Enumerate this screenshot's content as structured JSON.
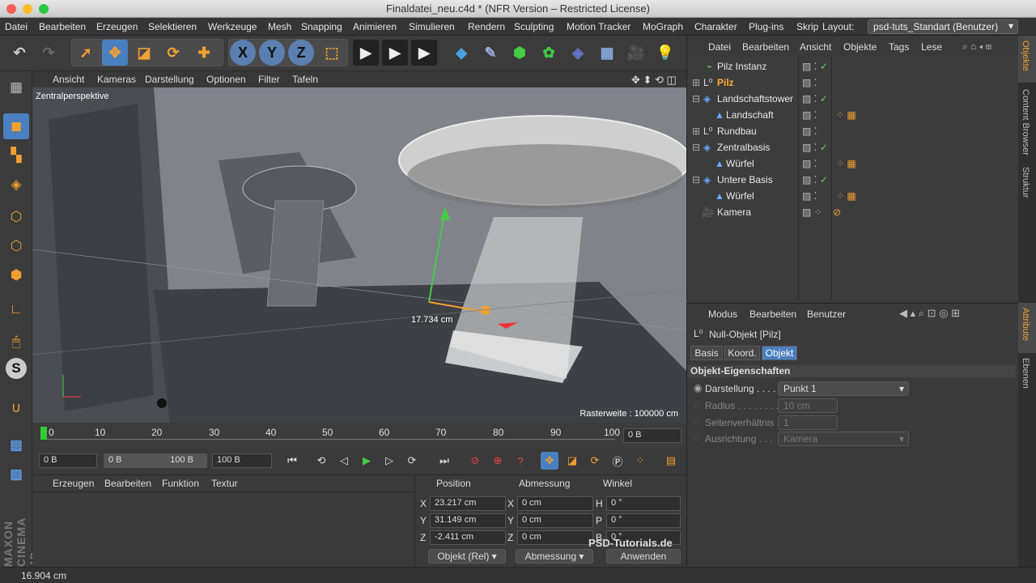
{
  "window": {
    "title": "Finaldatei_neu.c4d * (NFR Version – Restricted License)"
  },
  "menubar": {
    "items": [
      "Datei",
      "Bearbeiten",
      "Erzeugen",
      "Selektieren",
      "Werkzeuge",
      "Mesh",
      "Snapping",
      "Animieren",
      "Simulieren",
      "Rendern",
      "Sculpting",
      "Motion Tracker",
      "MoGraph",
      "Charakter",
      "Plug-ins",
      "Skrip"
    ],
    "layout_label": "Layout:",
    "layout_value": "psd-tuts_Standart (Benutzer)"
  },
  "toolbar": {
    "axis_x": "X",
    "axis_y": "Y",
    "axis_z": "Z"
  },
  "viewport": {
    "menu": [
      "Ansicht",
      "Kameras",
      "Darstellung",
      "Optionen",
      "Filter",
      "Tafeln"
    ],
    "camera_label": "Zentralperspektive",
    "measure_label": "17.734 cm",
    "grid_label": "Rasterweite : 100000 cm"
  },
  "timeline": {
    "ticks": [
      "0",
      "10",
      "20",
      "30",
      "40",
      "50",
      "60",
      "70",
      "80",
      "90",
      "100"
    ],
    "current_frame": "0 B"
  },
  "transport": {
    "start_field": "0 B",
    "range_start": "0 B",
    "range_end": "100 B",
    "end_field": "100 B"
  },
  "material_panel": {
    "menu": [
      "Erzeugen",
      "Bearbeiten",
      "Funktion",
      "Textur"
    ]
  },
  "coords": {
    "headers": [
      "Position",
      "Abmessung",
      "Winkel"
    ],
    "rows": [
      {
        "axis": "X",
        "pos": "23.217 cm",
        "dim_axis": "X",
        "dim": "0 cm",
        "ang_axis": "H",
        "ang": "0 °"
      },
      {
        "axis": "Y",
        "pos": "31.149 cm",
        "dim_axis": "Y",
        "dim": "0 cm",
        "ang_axis": "P",
        "ang": "0 °"
      },
      {
        "axis": "Z",
        "pos": "-2.411 cm",
        "dim_axis": "Z",
        "dim": "0 cm",
        "ang_axis": "B",
        "ang": "0 °"
      }
    ],
    "mode_select": "Objekt (Rel)",
    "dim_select": "Abmessung",
    "apply_button": "Anwenden"
  },
  "object_manager": {
    "menu": [
      "Datei",
      "Bearbeiten",
      "Ansicht",
      "Objekte",
      "Tags",
      "Lese"
    ],
    "objects": [
      {
        "name": "Pilz Instanz",
        "indent": 1,
        "highlight": false
      },
      {
        "name": "Pilz",
        "indent": 0,
        "highlight": true
      },
      {
        "name": "Landschaftstower",
        "indent": 0,
        "highlight": false
      },
      {
        "name": "Landschaft",
        "indent": 1,
        "highlight": false
      },
      {
        "name": "Rundbau",
        "indent": 0,
        "highlight": false
      },
      {
        "name": "Zentralbasis",
        "indent": 0,
        "highlight": false
      },
      {
        "name": "Würfel",
        "indent": 1,
        "highlight": false
      },
      {
        "name": "Untere Basis",
        "indent": 0,
        "highlight": false
      },
      {
        "name": "Würfel",
        "indent": 1,
        "highlight": false
      },
      {
        "name": "Kamera",
        "indent": 0,
        "highlight": false
      }
    ]
  },
  "attribute_manager": {
    "menu": [
      "Modus",
      "Bearbeiten",
      "Benutzer"
    ],
    "object_title": "Null-Objekt [Pilz]",
    "tabs": [
      "Basis",
      "Koord.",
      "Objekt"
    ],
    "active_tab": "Objekt",
    "section": "Objekt-Eigenschaften",
    "props": [
      {
        "label": "Darstellung . . . .",
        "value": "Punkt 1",
        "enabled": true
      },
      {
        "label": "Radius . . . . . . . .",
        "value": "10 cm",
        "enabled": false
      },
      {
        "label": "Seitenverhältnis",
        "value": "1",
        "enabled": false
      },
      {
        "label": "Ausrichtung . . .",
        "value": "Kamera",
        "enabled": false
      }
    ]
  },
  "side_tabs": [
    "Objekte",
    "Content Browser",
    "Struktur",
    "Attribute",
    "Ebenen"
  ],
  "status": {
    "text": "16.904 cm"
  },
  "brand": {
    "cinema": "MAXON CINEMA 4D",
    "watermark": "PSD-Tutorials.de"
  },
  "colors": {
    "accent_orange": "#f0a030",
    "highlight_blue": "#4a7fc0",
    "check_green": "#5cd65c",
    "title_text": "#ffa830"
  }
}
